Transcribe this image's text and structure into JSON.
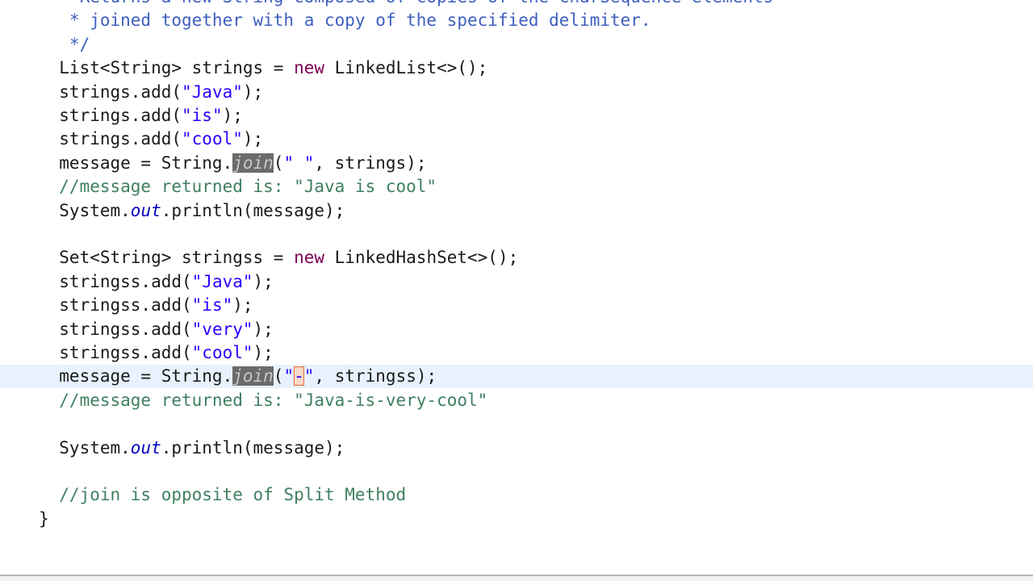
{
  "lines": [
    {
      "id": "doc1",
      "tokens": [
        {
          "cls": "tok-doc",
          "text": "    Returns a new String composed of copies of the CharSequence elements"
        }
      ]
    },
    {
      "id": "doc2",
      "tokens": [
        {
          "cls": "tok-doc",
          "text": "   * joined together with a copy of the specified delimiter."
        }
      ]
    },
    {
      "id": "doc3",
      "tokens": [
        {
          "cls": "tok-doc",
          "text": "   */"
        }
      ]
    },
    {
      "id": "list-decl",
      "tokens": [
        {
          "cls": "",
          "text": "  List<String> strings = "
        },
        {
          "cls": "tok-kw",
          "text": "new"
        },
        {
          "cls": "",
          "text": " LinkedList<>();"
        }
      ]
    },
    {
      "id": "add-java",
      "tokens": [
        {
          "cls": "",
          "text": "  strings.add("
        },
        {
          "cls": "tok-str",
          "text": "\"Java\""
        },
        {
          "cls": "",
          "text": ");"
        }
      ]
    },
    {
      "id": "add-is",
      "tokens": [
        {
          "cls": "",
          "text": "  strings.add("
        },
        {
          "cls": "tok-str",
          "text": "\"is\""
        },
        {
          "cls": "",
          "text": ");"
        }
      ]
    },
    {
      "id": "add-cool",
      "tokens": [
        {
          "cls": "",
          "text": "  strings.add("
        },
        {
          "cls": "tok-str",
          "text": "\"cool\""
        },
        {
          "cls": "",
          "text": ");"
        }
      ]
    },
    {
      "id": "join1",
      "tokens": [
        {
          "cls": "",
          "text": "  message = String."
        },
        {
          "cls": "tok-hl",
          "text": "join"
        },
        {
          "cls": "",
          "text": "("
        },
        {
          "cls": "tok-str",
          "text": "\" \""
        },
        {
          "cls": "",
          "text": ", strings);"
        }
      ]
    },
    {
      "id": "comment1",
      "tokens": [
        {
          "cls": "tok-comment",
          "text": "  //message returned is: \"Java is cool\""
        }
      ]
    },
    {
      "id": "println1",
      "tokens": [
        {
          "cls": "",
          "text": "  System."
        },
        {
          "cls": "tok-field",
          "text": "out"
        },
        {
          "cls": "",
          "text": ".println(message);"
        }
      ]
    },
    {
      "id": "blank1",
      "tokens": [
        {
          "cls": "",
          "text": ""
        }
      ]
    },
    {
      "id": "set-decl",
      "tokens": [
        {
          "cls": "",
          "text": "  Set<String> stringss = "
        },
        {
          "cls": "tok-kw",
          "text": "new"
        },
        {
          "cls": "",
          "text": " LinkedHashSet<>();"
        }
      ]
    },
    {
      "id": "sadd-java",
      "tokens": [
        {
          "cls": "",
          "text": "  stringss.add("
        },
        {
          "cls": "tok-str",
          "text": "\"Java\""
        },
        {
          "cls": "",
          "text": ");"
        }
      ]
    },
    {
      "id": "sadd-is",
      "tokens": [
        {
          "cls": "",
          "text": "  stringss.add("
        },
        {
          "cls": "tok-str",
          "text": "\"is\""
        },
        {
          "cls": "",
          "text": ");"
        }
      ]
    },
    {
      "id": "sadd-very",
      "tokens": [
        {
          "cls": "",
          "text": "  stringss.add("
        },
        {
          "cls": "tok-str",
          "text": "\"very\""
        },
        {
          "cls": "",
          "text": ");"
        }
      ]
    },
    {
      "id": "sadd-cool",
      "tokens": [
        {
          "cls": "",
          "text": "  stringss.add("
        },
        {
          "cls": "tok-str",
          "text": "\"cool\""
        },
        {
          "cls": "",
          "text": ");"
        }
      ]
    },
    {
      "id": "join2",
      "current": true,
      "tokens": [
        {
          "cls": "",
          "text": "  message = String."
        },
        {
          "cls": "tok-hl",
          "text": "join"
        },
        {
          "cls": "",
          "text": "("
        },
        {
          "cls": "tok-str",
          "text": "\""
        },
        {
          "cls": "tok-str tok-caret",
          "text": "-"
        },
        {
          "cls": "tok-str",
          "text": "\""
        },
        {
          "cls": "",
          "text": ", stringss);"
        }
      ]
    },
    {
      "id": "comment2",
      "tokens": [
        {
          "cls": "tok-comment",
          "text": "  //message returned is: \"Java-is-very-cool\""
        }
      ]
    },
    {
      "id": "blank2",
      "tokens": [
        {
          "cls": "",
          "text": ""
        }
      ]
    },
    {
      "id": "println2",
      "tokens": [
        {
          "cls": "",
          "text": "  System."
        },
        {
          "cls": "tok-field",
          "text": "out"
        },
        {
          "cls": "",
          "text": ".println(message);"
        }
      ]
    },
    {
      "id": "blank3",
      "tokens": [
        {
          "cls": "",
          "text": ""
        }
      ]
    },
    {
      "id": "comment3",
      "tokens": [
        {
          "cls": "tok-comment",
          "text": "  //join is opposite of Split Method"
        }
      ]
    },
    {
      "id": "close-brace",
      "tokens": [
        {
          "cls": "",
          "text": "}"
        }
      ]
    }
  ]
}
